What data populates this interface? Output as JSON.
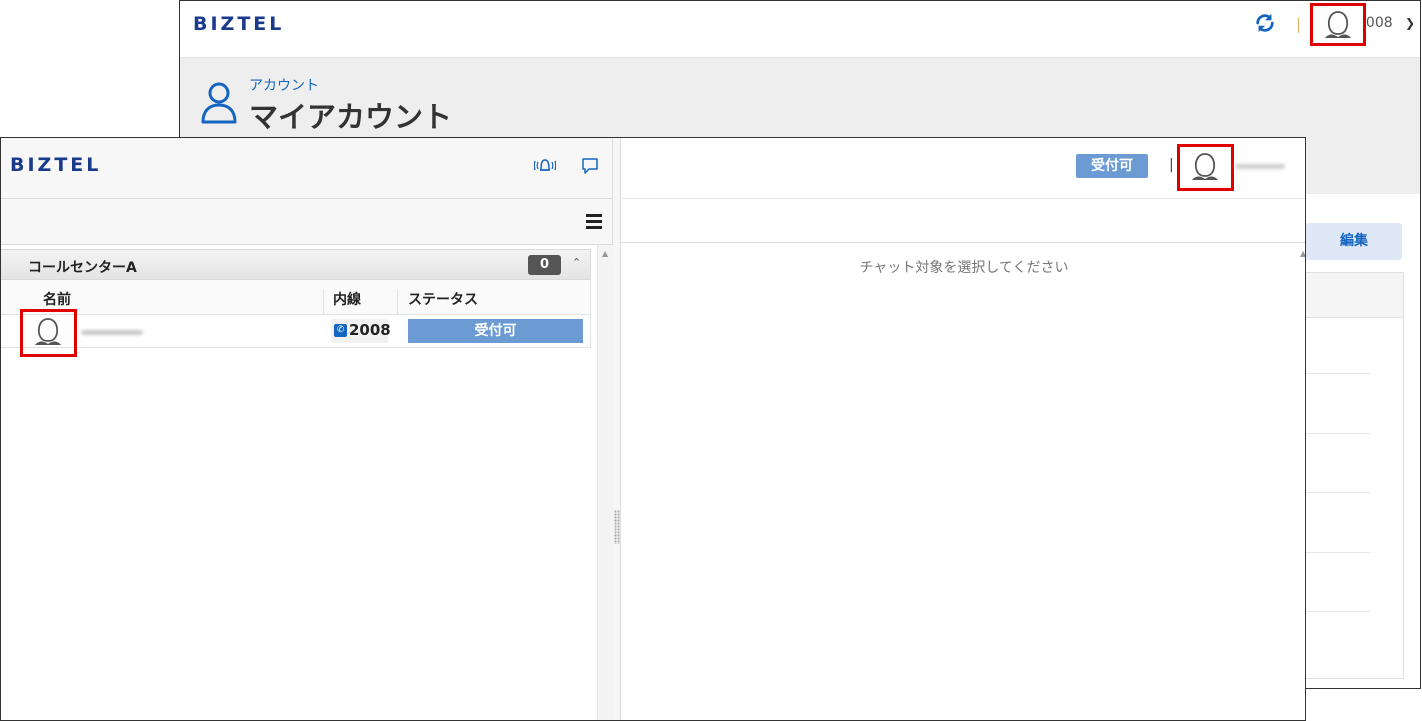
{
  "back_window": {
    "logo": "BIZTEL",
    "extension": "2008",
    "breadcrumb": "アカウント",
    "page_title": "マイアカウント",
    "edit_button": "編集",
    "icons": [
      "refresh-icon",
      "avatar-icon",
      "caret-down-icon",
      "person-icon"
    ],
    "accent_color": "#1565c0",
    "highlight_color": "#e00000"
  },
  "front_window": {
    "logo": "BIZTEL",
    "icons": [
      "notification-icon",
      "chat-icon",
      "hamburger-menu-icon",
      "collapse-icon",
      "phone-icon",
      "avatar-icon"
    ],
    "group": {
      "name": "コールセンターA",
      "count": "0"
    },
    "columns": [
      "名前",
      "内線",
      "ステータス"
    ],
    "rows": [
      {
        "name": "",
        "extension": "2008",
        "status": "受付可"
      }
    ],
    "header_status": "受付可",
    "chat_placeholder": "チャット対象を選択してください",
    "status_color": "#6b9bd2"
  }
}
